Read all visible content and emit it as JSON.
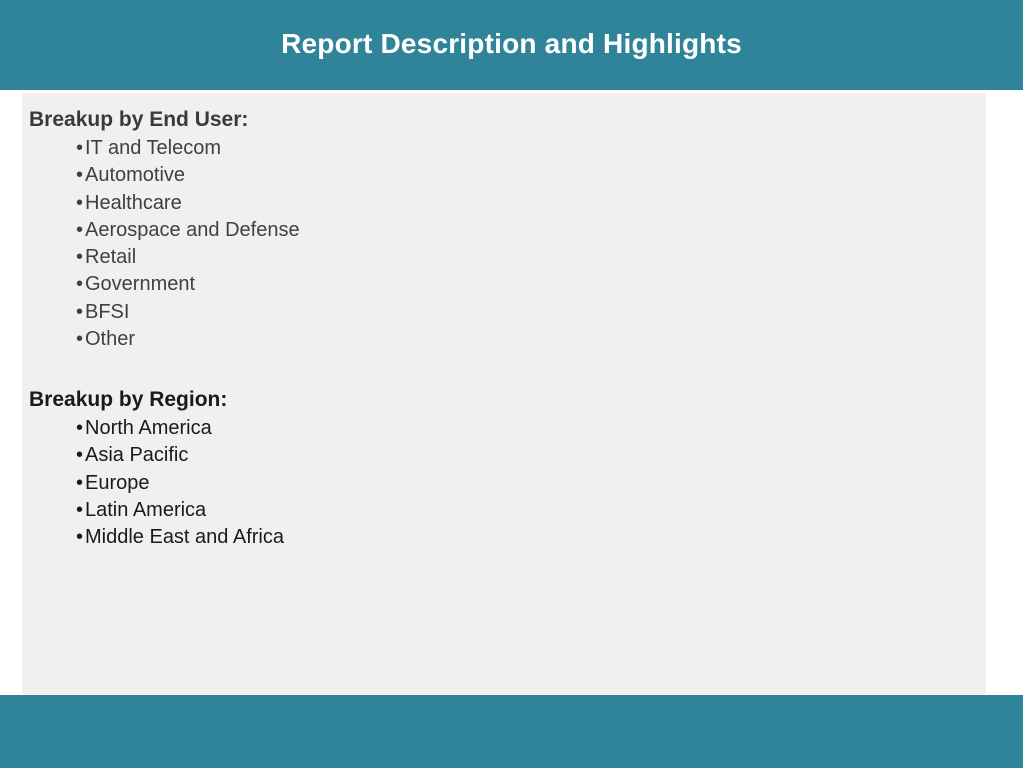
{
  "header": {
    "title": "Report Description and Highlights"
  },
  "end_user_section": {
    "heading": "Breakup by End User:",
    "items": [
      "IT and Telecom",
      "Automotive",
      "Healthcare",
      "Aerospace and Defense",
      "Retail",
      "Government",
      "BFSI",
      "Other"
    ]
  },
  "region_section": {
    "heading": "Breakup by Region:",
    "items": [
      "North America",
      "Asia Pacific",
      "Europe",
      "Latin America",
      "Middle East and Africa"
    ]
  },
  "colors": {
    "banner": "#2f8499",
    "panel": "#f0f0f0",
    "title_text": "#ffffff"
  }
}
